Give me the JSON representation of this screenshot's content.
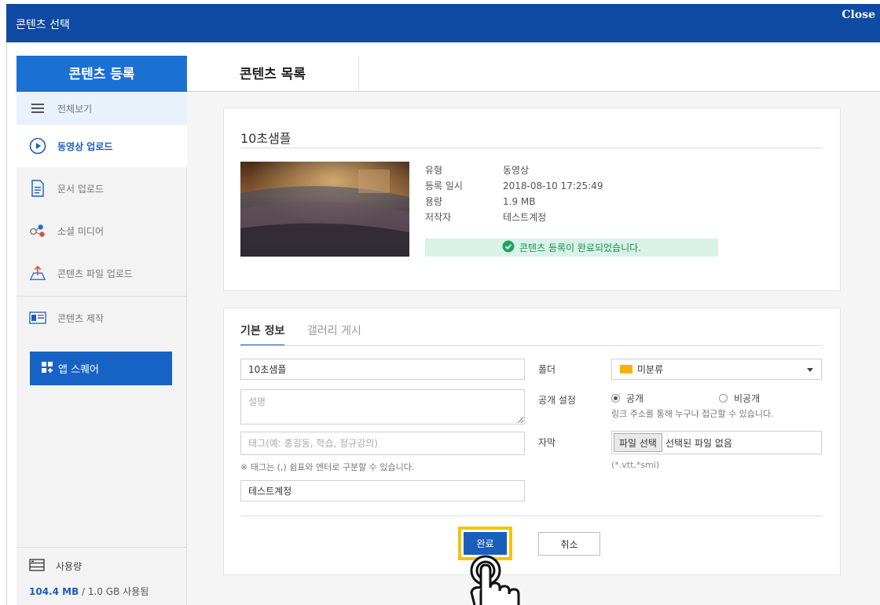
{
  "window": {
    "title": "콘텐츠 선택",
    "close_label": "Close"
  },
  "tabs": {
    "register": "콘텐츠 등록",
    "list": "콘텐츠 목록"
  },
  "sidebar": {
    "items": [
      {
        "label": "전체보기",
        "icon": "menu-icon"
      },
      {
        "label": "동영상 업로드",
        "icon": "play-circle-icon"
      },
      {
        "label": "문서 업로드",
        "icon": "document-icon"
      },
      {
        "label": "소셜 미디어",
        "icon": "social-icon"
      },
      {
        "label": "콘텐츠 파일 업로드",
        "icon": "upload-icon"
      },
      {
        "label": "콘텐츠 제작",
        "icon": "id-card-icon"
      }
    ],
    "app_square": "앱 스퀘어",
    "usage": {
      "label": "사용량",
      "used": "104.4 MB",
      "rest": " / 1.0 GB 사용됨"
    }
  },
  "content_card": {
    "name": "10초샘플",
    "meta": [
      {
        "label": "유형",
        "value": "동영상"
      },
      {
        "label": "등록 일시",
        "value": "2018-08-10 17:25:49"
      },
      {
        "label": "용량",
        "value": "1.9 MB"
      },
      {
        "label": "저작자",
        "value": "테스트계정"
      }
    ],
    "success_message": "콘텐츠 등록이 완료되었습니다."
  },
  "form": {
    "tabs": {
      "basic": "기본 정보",
      "gallery": "갤러리 게시"
    },
    "title_value": "10초샘플",
    "description_placeholder": "설명",
    "tag_placeholder": "태그(예: 홍길동, 학습, 정규강의)",
    "tag_note": "※ 태그는 (,) 쉼표와 엔터로 구분할 수 있습니다.",
    "author_value": "테스트계정",
    "folder_label": "폴더",
    "folder_value": "미분류",
    "visibility_label": "공개 설정",
    "visibility_public": "공개",
    "visibility_private": "비공개",
    "visibility_note": "링크 주소를 통해 누구나 접근할 수 있습니다.",
    "subtitle_label": "자막",
    "file_button": "파일 선택",
    "file_status": "선택된 파일 없음",
    "subtitle_note": "(*.vtt,*smi)",
    "done_button": "완료",
    "cancel_button": "취소"
  },
  "colors": {
    "titlebar": "#0f4aa3",
    "accent": "#1b70d3",
    "success_bg": "#d9f2e5",
    "highlight": "#f2c500"
  }
}
